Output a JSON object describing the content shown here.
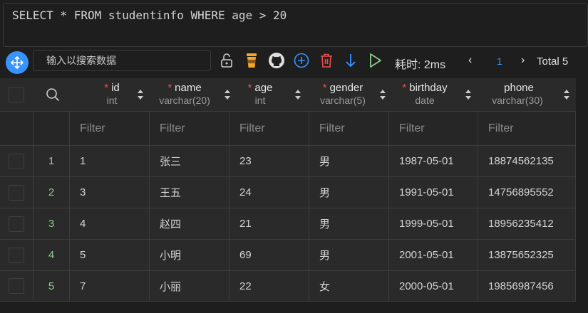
{
  "editor": {
    "sql": "SELECT * FROM studentinfo WHERE age > 20"
  },
  "toolbar": {
    "search_placeholder": "输入以搜索数据",
    "elapsed": "耗时: 2ms",
    "prev": "‹",
    "page": "1",
    "next": "›",
    "total": "Total 5"
  },
  "columns": [
    {
      "name": "id",
      "type": "int",
      "required": "*"
    },
    {
      "name": "name",
      "type": "varchar(20)",
      "required": "*"
    },
    {
      "name": "age",
      "type": "int",
      "required": "*"
    },
    {
      "name": "gender",
      "type": "varchar(5)",
      "required": "*"
    },
    {
      "name": "birthday",
      "type": "date",
      "required": "*"
    },
    {
      "name": "phone",
      "type": "varchar(30)",
      "required": ""
    }
  ],
  "filter_label": "Filter",
  "rows": [
    {
      "num": "1",
      "cells": [
        "1",
        "张三",
        "23",
        "男",
        "1987-05-01",
        "18874562135"
      ]
    },
    {
      "num": "2",
      "cells": [
        "3",
        "王五",
        "24",
        "男",
        "1991-05-01",
        "14756895552"
      ]
    },
    {
      "num": "3",
      "cells": [
        "4",
        "赵四",
        "21",
        "男",
        "1999-05-01",
        "18956235412"
      ]
    },
    {
      "num": "4",
      "cells": [
        "5",
        "小明",
        "69",
        "男",
        "2001-05-01",
        "13875652325"
      ]
    },
    {
      "num": "5",
      "cells": [
        "7",
        "小丽",
        "22",
        "女",
        "2000-05-01",
        "19856987456"
      ]
    }
  ],
  "colors": {
    "accent": "#3794ff",
    "required": "#f14c4c",
    "rownum": "#89d185",
    "delete": "#f14c4c",
    "run": "#89d185"
  }
}
